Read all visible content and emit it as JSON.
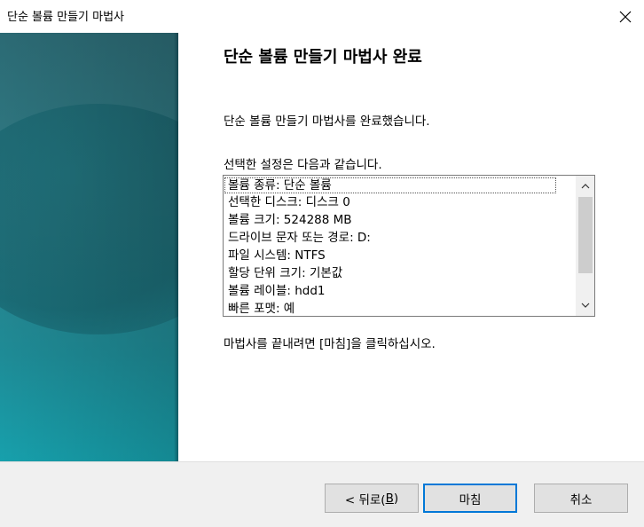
{
  "window": {
    "title": "단순 볼륨 만들기 마법사"
  },
  "content": {
    "heading": "단순 볼륨 만들기 마법사 완료",
    "completed_text": "단순 볼륨 만들기 마법사를 완료했습니다.",
    "settings_intro": "선택한 설정은 다음과 같습니다.",
    "summary_lines": [
      "볼륨 종류: 단순 볼륨",
      "선택한 디스크: 디스크 0",
      "볼륨 크기: 524288 MB",
      "드라이브 문자 또는 경로: D:",
      "파일 시스템: NTFS",
      "할당 단위 크기: 기본값",
      "볼륨 레이블: hdd1",
      "빠른 포맷: 예"
    ],
    "finish_instruction": "마법사를 끝내려면 [마침]을 클릭하십시오."
  },
  "buttons": {
    "back_prefix": "< 뒤로(",
    "back_mnemonic": "B",
    "back_suffix": ")",
    "finish": "마침",
    "cancel": "취소"
  },
  "icons": {
    "close": "close-icon",
    "scroll_up": "chevron-up-icon",
    "scroll_down": "chevron-down-icon"
  },
  "colors": {
    "panel_teal": "#2f7d86",
    "primary_border": "#0078d7",
    "button_bg": "#e1e1e1"
  }
}
